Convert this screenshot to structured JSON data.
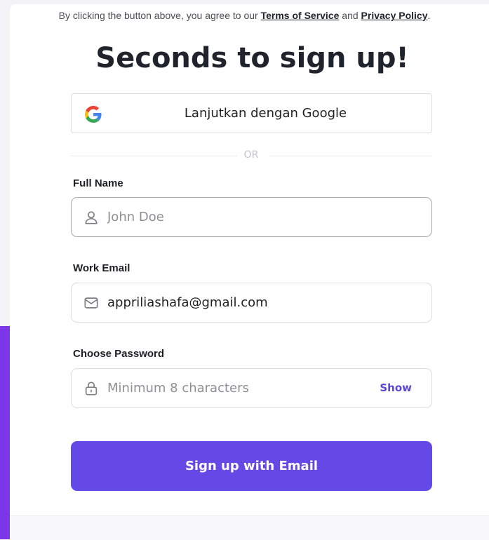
{
  "title": "Seconds to sign up!",
  "google_button": {
    "label": "Lanjutkan dengan Google",
    "icon": "google-g-icon"
  },
  "divider": {
    "text": "OR"
  },
  "fields": {
    "full_name": {
      "label": "Full Name",
      "value": "",
      "placeholder": "John Doe",
      "icon": "user-icon"
    },
    "work_email": {
      "label": "Work Email",
      "value": "appriliashafa@gmail.com",
      "placeholder": "",
      "icon": "envelope-icon"
    },
    "password": {
      "label": "Choose Password",
      "value": "",
      "placeholder": "Minimum 8 characters",
      "icon": "lock-icon",
      "toggle_label": "Show"
    }
  },
  "signup_button": {
    "label": "Sign up with Email"
  },
  "footer": {
    "prefix": "By clicking the button above, you agree to our ",
    "terms": "Terms of Service",
    "and": " and ",
    "privacy": "Privacy Policy",
    "suffix": "."
  },
  "colors": {
    "accent": "#6549e6",
    "link": "#5a47d8",
    "edge": "#7c35e8"
  }
}
